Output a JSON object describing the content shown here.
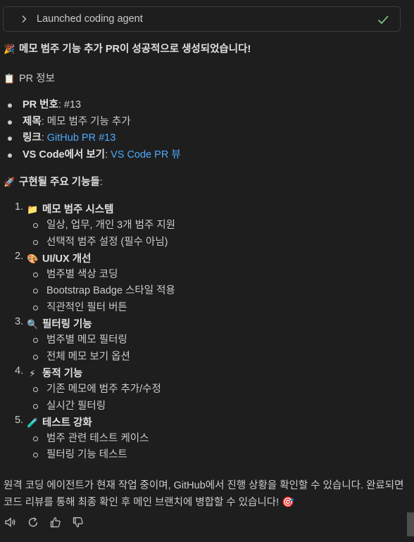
{
  "agent_bar": {
    "label": "Launched coding agent",
    "chevron_icon": "chevron-right-icon",
    "status_icon": "check-icon",
    "status_color": "#89d185"
  },
  "title": {
    "emoji": "🎉",
    "text": "메모 범주 기능 추가 PR이 성공적으로 생성되었습니다!"
  },
  "pr_info": {
    "emoji": "📋",
    "heading": "PR 정보",
    "items": [
      {
        "key": "PR 번호",
        "sep": ": ",
        "value": "#13"
      },
      {
        "key": "제목",
        "sep": ": ",
        "value": "메모 범주 기능 추가"
      },
      {
        "key": "링크",
        "sep": ": ",
        "link": "GitHub PR #13"
      },
      {
        "key": "VS Code에서 보기",
        "sep": ": ",
        "link": "VS Code PR 뷰"
      }
    ]
  },
  "features": {
    "emoji": "🚀",
    "heading": "구현될 주요 기능들",
    "suffix": ":",
    "sections": [
      {
        "num": "1.",
        "emoji": "📁",
        "title": "메모 범주 시스템",
        "items": [
          "일상, 업무, 개인 3개 범주 지원",
          "선택적 범주 설정 (필수 아님)"
        ]
      },
      {
        "num": "2.",
        "emoji": "🎨",
        "title": "UI/UX 개선",
        "items": [
          "범주별 색상 코딩",
          "Bootstrap Badge 스타일 적용",
          "직관적인 필터 버튼"
        ]
      },
      {
        "num": "3.",
        "emoji": "🔍",
        "title": "필터링 기능",
        "items": [
          "범주별 메모 필터링",
          "전체 메모 보기 옵션"
        ]
      },
      {
        "num": "4.",
        "emoji": "⚡",
        "title": "동적 기능",
        "items": [
          "기존 메모에 범주 추가/수정",
          "실시간 필터링"
        ]
      },
      {
        "num": "5.",
        "emoji": "🧪",
        "title": "테스트 강화",
        "items": [
          "범주 관련 테스트 케이스",
          "필터링 기능 테스트"
        ]
      }
    ]
  },
  "closing": {
    "text": "원격 코딩 에이전트가 현재 작업 중이며, GitHub에서 진행 상황을 확인할 수 있습니다. 완료되면 코드 리뷰를 통해 최종 확인 후 메인 브랜치에 병합할 수 있습니다!",
    "emoji": "🎯"
  },
  "actions": [
    "speaker-icon",
    "retry-icon",
    "thumbs-up-icon",
    "thumbs-down-icon"
  ],
  "colors": {
    "background": "#1e1e1e",
    "text": "#cccccc",
    "link": "#4daafc"
  }
}
